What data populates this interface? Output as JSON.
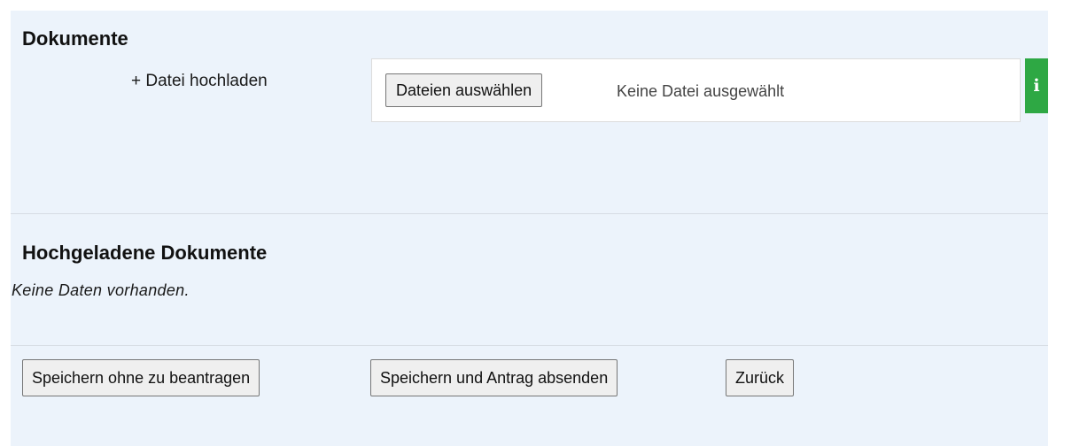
{
  "documents_section": {
    "title": "Dokumente",
    "upload_label": "+ Datei hochladen",
    "file_button_label": "Dateien auswählen",
    "file_status": "Keine Datei ausgewählt",
    "info_icon": "i",
    "info_icon_name": "info-icon",
    "info_color": "#2ea844"
  },
  "uploaded_section": {
    "title": "Hochgeladene Dokumente",
    "empty_text": "Keine Daten vorhanden."
  },
  "actions": {
    "save_without_apply": "Speichern ohne zu beantragen",
    "save_and_submit": "Speichern und Antrag absenden",
    "back": "Zurück"
  },
  "colors": {
    "panel_background": "#ecf3fb",
    "button_background": "#efefef"
  }
}
